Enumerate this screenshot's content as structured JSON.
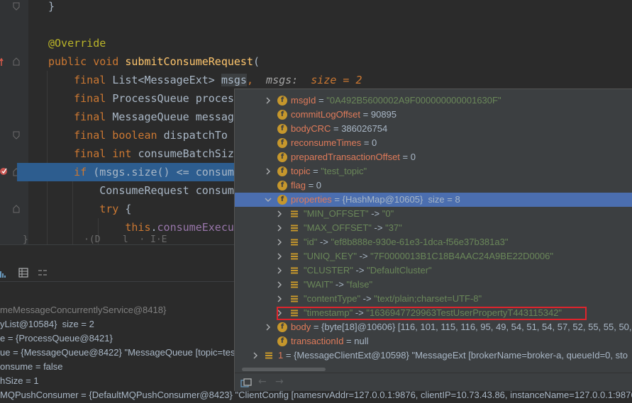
{
  "editor": {
    "lines": [
      {
        "parts": [
          {
            "t": "}",
            "c": "typ"
          }
        ]
      },
      {
        "parts": []
      },
      {
        "parts": [
          {
            "t": "@Override",
            "c": "ann"
          }
        ]
      },
      {
        "parts": [
          {
            "t": "public void ",
            "c": "kw"
          },
          {
            "t": "submitConsumeRequest",
            "c": "fn"
          },
          {
            "t": "(",
            "c": "typ"
          }
        ]
      },
      {
        "parts": [
          {
            "t": "    final ",
            "c": "kw"
          },
          {
            "t": "List<MessageExt> ",
            "c": "typ"
          },
          {
            "t": "msgs",
            "c": "typ"
          },
          {
            "t": ",",
            "c": "kw"
          },
          {
            "t": "  msgs:  ",
            "c": "inl-name"
          },
          {
            "t": "size = 2",
            "c": "inl-val"
          }
        ]
      },
      {
        "parts": [
          {
            "t": "    final ",
            "c": "kw"
          },
          {
            "t": "ProcessQueue proces",
            "c": "typ"
          }
        ]
      },
      {
        "parts": [
          {
            "t": "    final ",
            "c": "kw"
          },
          {
            "t": "MessageQueue messag",
            "c": "typ"
          }
        ]
      },
      {
        "parts": [
          {
            "t": "    final boolean ",
            "c": "kw"
          },
          {
            "t": "dispatchTo",
            "c": "typ"
          }
        ]
      },
      {
        "parts": [
          {
            "t": "    final int ",
            "c": "kw"
          },
          {
            "t": "consumeBatchSiz",
            "c": "typ"
          }
        ]
      },
      {
        "parts": [
          {
            "t": "    if ",
            "c": "kw"
          },
          {
            "t": "(msgs.size() <= consum",
            "c": "typ"
          }
        ]
      },
      {
        "parts": [
          {
            "t": "        ConsumeRequest consum",
            "c": "typ"
          }
        ]
      },
      {
        "parts": [
          {
            "t": "        try ",
            "c": "kw"
          },
          {
            "t": "{",
            "c": "typ"
          }
        ]
      },
      {
        "parts": [
          {
            "t": "            this",
            "c": "kw"
          },
          {
            "t": ".",
            "c": "typ"
          },
          {
            "t": "consumeExecu",
            "c": "ctx"
          }
        ]
      }
    ]
  },
  "debugger": {
    "vars": [
      {
        "text": "meMessageConcurrentlyService@8418}",
        "gray": true
      },
      {
        "text": "yList@10584}  size = 2",
        "gray": false
      },
      {
        "text": "e = {ProcessQueue@8421}",
        "gray": false
      },
      {
        "text": "ue = {MessageQueue@8422} \"MessageQueue [topic=tes",
        "gray": false
      },
      {
        "text": "onsume = false",
        "gray": false
      },
      {
        "text": "hSize = 1",
        "gray": false
      },
      {
        "text": "MQPushConsumer = {DefaultMQPushConsumer@8423} \"ClientConfig [namesrvAddr=127.0.0.1:9876, clientIP=10.73.43.86, instanceName=127.0.0.1:9876@15",
        "gray": false
      }
    ]
  },
  "popup": {
    "nodes": [
      {
        "level": 1,
        "icon": "f",
        "arrow": "right",
        "name": "msgId",
        "eq": " = ",
        "value": "\"0A492B5600002A9F000000000001630F\"",
        "vclass": "str"
      },
      {
        "level": 1,
        "icon": "f",
        "arrow": "",
        "name": "commitLogOffset",
        "eq": " = ",
        "value": "90895",
        "vclass": "eq"
      },
      {
        "level": 1,
        "icon": "f",
        "arrow": "",
        "name": "bodyCRC",
        "eq": " = ",
        "value": "386026754",
        "vclass": "eq"
      },
      {
        "level": 1,
        "icon": "f",
        "arrow": "",
        "name": "reconsumeTimes",
        "eq": " = ",
        "value": "0",
        "vclass": "eq"
      },
      {
        "level": 1,
        "icon": "f",
        "arrow": "",
        "name": "preparedTransactionOffset",
        "eq": " = ",
        "value": "0",
        "vclass": "eq"
      },
      {
        "level": 1,
        "icon": "f",
        "arrow": "right",
        "name": "topic",
        "eq": " = ",
        "value": "\"test_topic\"",
        "vclass": "str"
      },
      {
        "level": 1,
        "icon": "f",
        "arrow": "",
        "name": "flag",
        "eq": " = ",
        "value": "0",
        "vclass": "eq"
      },
      {
        "level": 1,
        "icon": "f",
        "arrow": "down",
        "name": "properties",
        "eq": " = ",
        "value": "{HashMap@10605}  size = 8",
        "vclass": "eq",
        "selected": true
      },
      {
        "level": 2,
        "icon": "list",
        "arrow": "right",
        "name": "\"MIN_OFFSET\"",
        "eq": " -> ",
        "value": "\"0\"",
        "vclass": "str"
      },
      {
        "level": 2,
        "icon": "list",
        "arrow": "right",
        "name": "\"MAX_OFFSET\"",
        "eq": " -> ",
        "value": "\"37\"",
        "vclass": "str"
      },
      {
        "level": 2,
        "icon": "list",
        "arrow": "right",
        "name": "\"id\"",
        "eq": " -> ",
        "value": "\"ef8b888e-930e-61e3-1dca-f56e37b381a3\"",
        "vclass": "str"
      },
      {
        "level": 2,
        "icon": "list",
        "arrow": "right",
        "name": "\"UNIQ_KEY\"",
        "eq": " -> ",
        "value": "\"7F0000013B1C18B4AAC24A9BE22D0006\"",
        "vclass": "str"
      },
      {
        "level": 2,
        "icon": "list",
        "arrow": "right",
        "name": "\"CLUSTER\"",
        "eq": " -> ",
        "value": "\"DefaultCluster\"",
        "vclass": "str"
      },
      {
        "level": 2,
        "icon": "list",
        "arrow": "right",
        "name": "\"WAIT\"",
        "eq": " -> ",
        "value": "\"false\"",
        "vclass": "str"
      },
      {
        "level": 2,
        "icon": "list",
        "arrow": "right",
        "name": "\"contentType\"",
        "eq": " -> ",
        "value": "\"text/plain;charset=UTF-8\"",
        "vclass": "str"
      },
      {
        "level": 2,
        "icon": "list",
        "arrow": "right",
        "name": "\"timestamp\"",
        "eq": " -> ",
        "value": "\"1636947729963TestUserProperty\u0001T443115342\"",
        "vclass": "str"
      },
      {
        "level": 1,
        "icon": "f",
        "arrow": "right",
        "name": "body",
        "eq": " = ",
        "value": "{byte[18]@10606} [116, 101, 115, 116, 95, 49, 54, 51, 54, 57, 52, 55, 55, 50, 5",
        "vclass": "eq",
        "refsplit": true
      },
      {
        "level": 1,
        "icon": "f",
        "arrow": "",
        "name": "transactionId",
        "eq": " = ",
        "value": "null",
        "vclass": "eq"
      },
      {
        "level": 0,
        "icon": "list",
        "arrow": "right",
        "name": "1",
        "eq": " = ",
        "value": "{MessageClientExt@10598} \"MessageExt [brokerName=broker-a, queueId=0, sto",
        "vclass": "eq",
        "refsplit": true
      }
    ]
  },
  "colors": {
    "selected": "#4b6eaf",
    "highlight_line": "#2d5d8f",
    "red_box": "#e0242c",
    "field_icon": "#c6972c"
  }
}
